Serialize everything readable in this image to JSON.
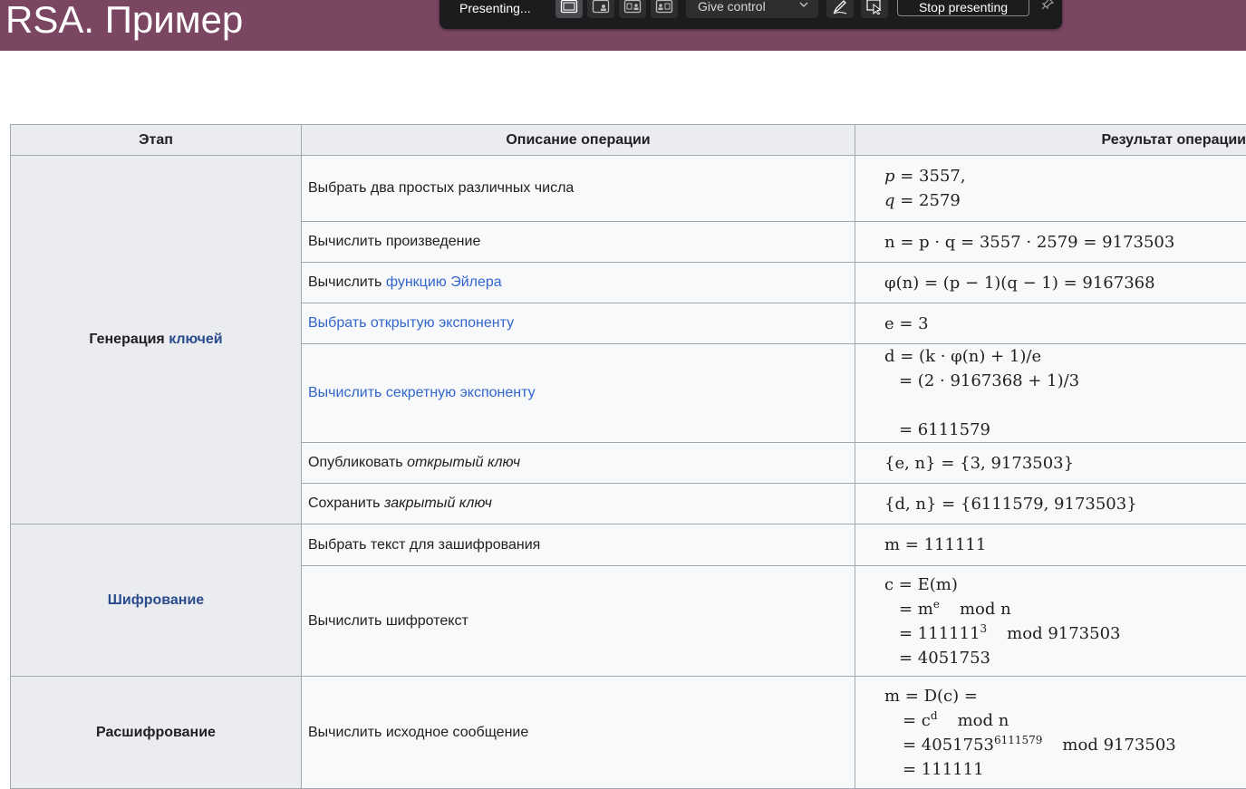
{
  "slide": {
    "title": "RSA. Пример"
  },
  "toolbar": {
    "status": "Presenting...",
    "give_control": "Give control",
    "stop_presenting": "Stop presenting",
    "icons": [
      "layout-full-icon",
      "layout-content-person-icon",
      "layout-side-by-side-icon",
      "layout-person-content-icon",
      "annotate-icon",
      "pointer-icon",
      "chevron-down-icon",
      "pin-icon"
    ]
  },
  "table": {
    "headers": [
      "Этап",
      "Описание операции",
      "Результат операции"
    ],
    "stages": {
      "keygen_prefix": "Генерация ",
      "keygen_link": "ключей",
      "encrypt": "Шифрование",
      "decrypt": "Расшифрование"
    },
    "rows": {
      "r1": {
        "desc": "Выбрать два простых различных числа",
        "l1a": "p",
        "l1b": " = 3557,",
        "l2a": "q",
        "l2b": " = 2579"
      },
      "r2": {
        "desc": "Вычислить произведение",
        "result": "n = p · q = 3557 · 2579 = 9173503"
      },
      "r3": {
        "desc_prefix": "Вычислить ",
        "desc_link": "функцию Эйлера",
        "result": "φ(n) = (p − 1)(q − 1) = 9167368"
      },
      "r4": {
        "desc_link": "Выбрать открытую экспоненту",
        "result": "e = 3"
      },
      "r5": {
        "desc_link": "Вычислить секретную экспоненту",
        "l1": "d = (k · φ(n) + 1)/e",
        "l2": "= (2 · 9167368 + 1)/3",
        "l3": "= 6111579"
      },
      "r6": {
        "desc_prefix": "Опубликовать ",
        "desc_em": "открытый ключ",
        "result": "{e, n} = {3, 9173503}"
      },
      "r7": {
        "desc_prefix": "Сохранить ",
        "desc_em": "закрытый ключ",
        "result": "{d, n} = {6111579, 9173503}"
      },
      "r8": {
        "desc": "Выбрать текст для зашифрования",
        "result": "m = 111111"
      },
      "r9": {
        "desc": "Вычислить шифротекст",
        "l1": "c = E(m)",
        "l2_base": "= m",
        "l2_exp": "e",
        "l2_mod": "mod  n",
        "l3_base": "= 111111",
        "l3_exp": "3",
        "l3_mod": "mod  9173503",
        "l4": "= 4051753"
      },
      "r10": {
        "desc": "Вычислить исходное сообщение",
        "l1": "m = D(c) =",
        "l2_base": "= c",
        "l2_exp": "d",
        "l2_mod": "mod  n",
        "l3_base": "= 4051753",
        "l3_exp": "6111579",
        "l3_mod": "mod  9173503",
        "l4": "= 111111"
      }
    }
  },
  "colors": {
    "header_bg": "#7a4662",
    "toolbar_bg": "#1c1c1e",
    "link": "#3366cc",
    "table_border": "#a2a9b1"
  }
}
